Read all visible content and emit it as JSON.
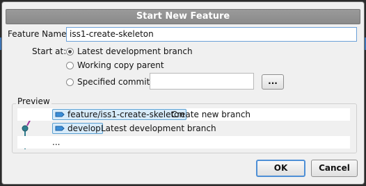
{
  "dialog": {
    "title": "Start New Feature",
    "feature_name_label": "Feature Name:",
    "feature_name_value": "iss1-create-skeleton",
    "start_at_label": "Start at:",
    "options": [
      {
        "label": "Latest development branch",
        "selected": true
      },
      {
        "label": "Working copy parent",
        "selected": false
      },
      {
        "label": "Specified commit:",
        "selected": false
      }
    ],
    "commit_value": "",
    "browse_label": "...",
    "preview_label": "Preview",
    "preview_rows": [
      {
        "tag": "feature/iss1-create-skeleton",
        "text": "Create new branch",
        "node_color": "#a0359a"
      },
      {
        "tag": "develop",
        "text": "Latest development branch",
        "node_color": "#2f7d8e"
      },
      {
        "tag": "",
        "text": "...",
        "node_color": "#2f7d8e"
      }
    ],
    "ok_label": "OK",
    "cancel_label": "Cancel"
  },
  "icons": {
    "branch_tag": "branch-icon"
  }
}
